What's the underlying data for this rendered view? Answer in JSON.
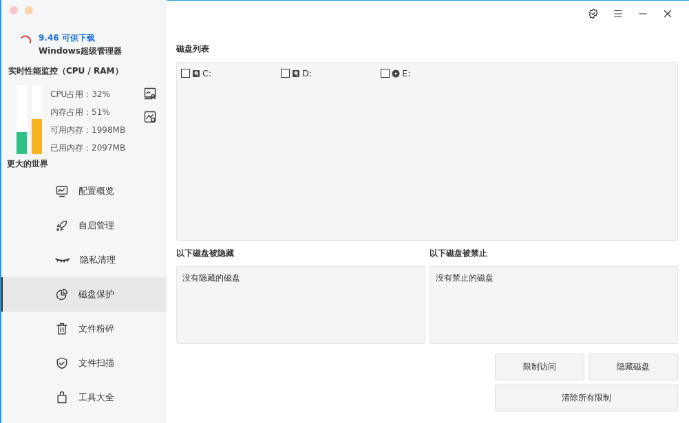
{
  "sidebar": {
    "update": {
      "version_text": "9.46 可供下载",
      "app_name": "Windows超级管理器"
    },
    "monitor": {
      "title": "实时性能监控（CPU / RAM）",
      "bars": [
        {
          "level": 0.32,
          "color": "#2ec286"
        },
        {
          "level": 0.51,
          "color": "#fbb321"
        }
      ],
      "stats": [
        "CPU占用：32%",
        "内存占用：51%",
        "可用内存：1998MB",
        "已用内存：2097MB"
      ]
    },
    "section_title": "更大的世界",
    "nav": [
      {
        "label": "配置概览",
        "selected": false
      },
      {
        "label": "自启管理",
        "selected": false
      },
      {
        "label": "隐私清理",
        "selected": false
      },
      {
        "label": "磁盘保护",
        "selected": true
      },
      {
        "label": "文件粉碎",
        "selected": false
      },
      {
        "label": "文件扫描",
        "selected": false
      },
      {
        "label": "工具大全",
        "selected": false
      }
    ]
  },
  "disk_list": {
    "title": "磁盘列表",
    "disks": [
      {
        "label": "C:",
        "kind": "hdd",
        "checked": false
      },
      {
        "label": "D:",
        "kind": "hdd",
        "checked": false
      },
      {
        "label": "E:",
        "kind": "optical",
        "checked": false
      }
    ]
  },
  "hidden_panel": {
    "title": "以下磁盘被隐藏",
    "text": "没有隐藏的磁盘"
  },
  "blocked_panel": {
    "title": "以下磁盘被禁止",
    "text": "没有禁止的磁盘"
  },
  "buttons": [
    "限制访问",
    "隐藏磁盘",
    "清除所有限制"
  ]
}
